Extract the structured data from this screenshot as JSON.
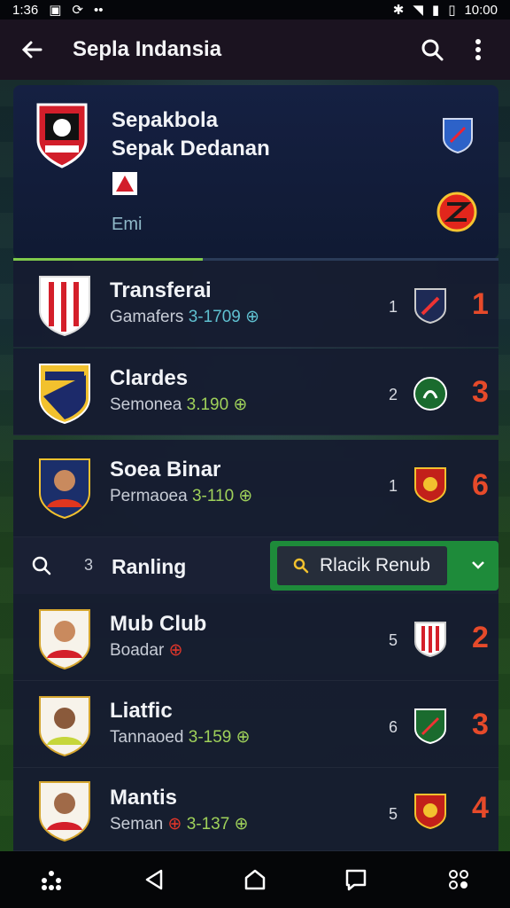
{
  "status": {
    "time": "1:36",
    "right_time": "10:00"
  },
  "appbar": {
    "title": "Sepla Indansia"
  },
  "hero": {
    "line1": "Sepakbola",
    "line2": "Sepak Dedanan",
    "sub": "Emi",
    "progress": 0.39
  },
  "rows_top": [
    {
      "name": "Transferai",
      "meta_label": "Gamafers",
      "meta_value": "3-1709",
      "num": "1",
      "rank": "1",
      "accent": "teal"
    },
    {
      "name": "Clardes",
      "meta_label": "Semonea",
      "meta_value": "3.190",
      "num": "2",
      "rank": "3",
      "accent": "green"
    },
    {
      "name": "Soea Binar",
      "meta_label": "Permaoea",
      "meta_value": "3-110",
      "num": "1",
      "rank": "6",
      "accent": "green"
    }
  ],
  "ranking": {
    "small": "3",
    "label": "Ranling",
    "button": "Rlacik Renub"
  },
  "rows_bottom": [
    {
      "name": "Mub Club",
      "meta_label": "Boadar",
      "meta_value": "",
      "num": "5",
      "rank": "2",
      "accent": "green"
    },
    {
      "name": "Liatfic",
      "meta_label": "Tannaoed",
      "meta_value": "3-159",
      "num": "6",
      "rank": "3",
      "accent": "green"
    },
    {
      "name": "Mantis",
      "meta_label": "Seman",
      "meta_value": "3-137",
      "num": "5",
      "rank": "4",
      "accent": "green"
    }
  ]
}
